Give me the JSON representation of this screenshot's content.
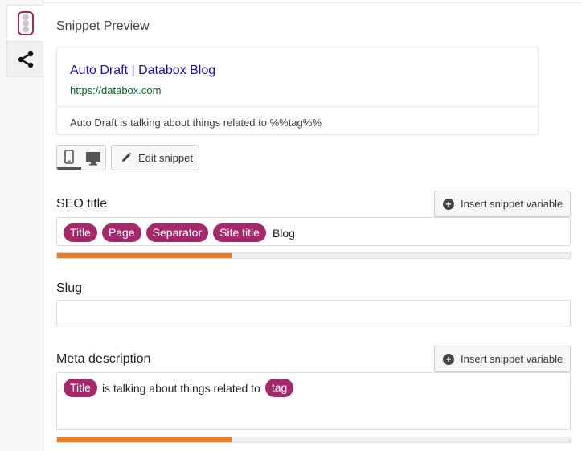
{
  "sidebar": {
    "tabs": [
      {
        "name": "readability-traffic-light-icon",
        "active": true
      },
      {
        "name": "share-icon",
        "active": false
      }
    ]
  },
  "panel": {
    "title": "Snippet Preview"
  },
  "preview": {
    "title": "Auto Draft | Databox Blog",
    "url": "https://databox.com",
    "description": "Auto Draft is talking about things related to %%tag%%"
  },
  "mode": {
    "mobile_icon": "mobile-icon",
    "desktop_icon": "desktop-icon",
    "edit_label": "Edit snippet"
  },
  "seo_title": {
    "label": "SEO title",
    "insert_label": "Insert snippet variable",
    "pills": [
      "Title",
      "Page",
      "Separator",
      "Site title"
    ],
    "trailing_text": "Blog",
    "progress": 0.34
  },
  "slug": {
    "label": "Slug",
    "value": ""
  },
  "meta_description": {
    "label": "Meta description",
    "insert_label": "Insert snippet variable",
    "pill_1": "Title",
    "middle_text": "is talking about things related to",
    "pill_2": "tag",
    "progress": 0.34
  },
  "colors": {
    "accent": "#a4286a",
    "progress": "#ee7c1b",
    "link": "#1a0dab",
    "url": "#006621"
  }
}
